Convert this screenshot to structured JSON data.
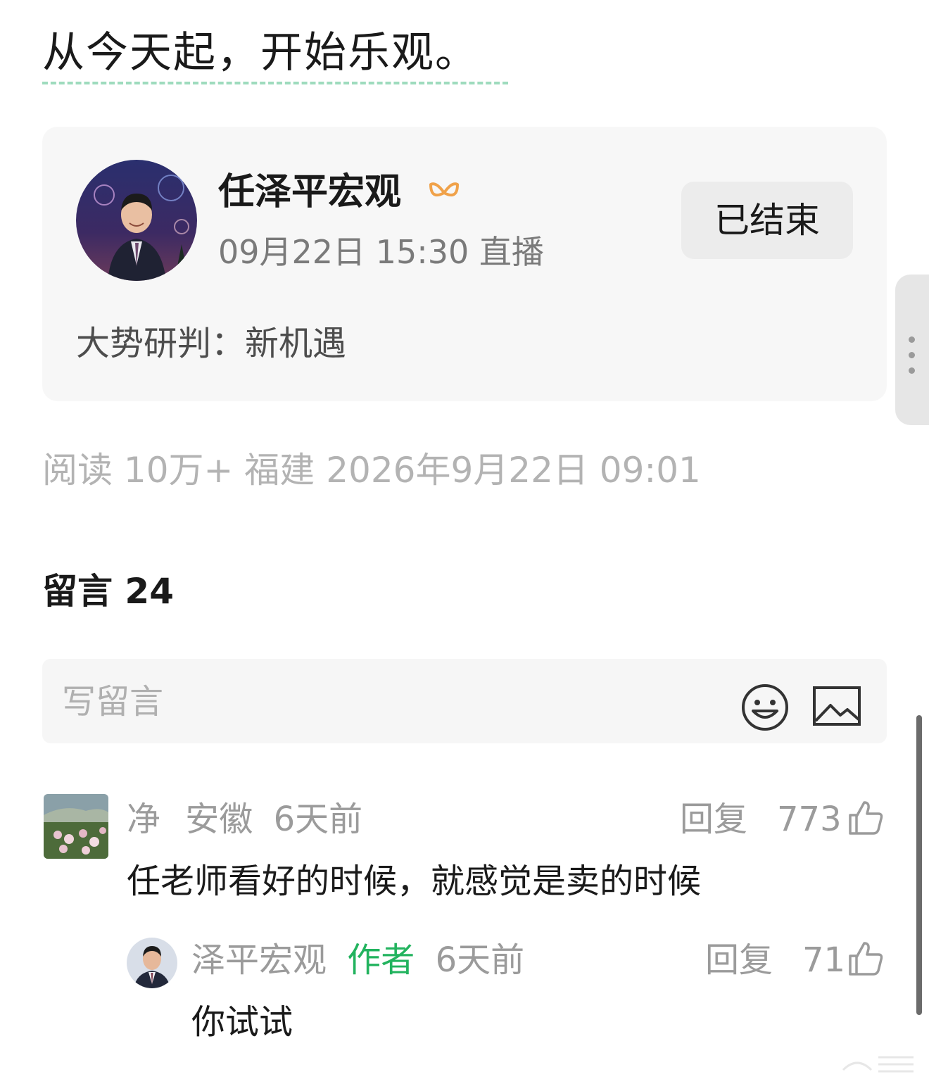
{
  "article": {
    "headline": "从今天起，开始乐观。"
  },
  "live_card": {
    "channel_name": "任泽平宏观",
    "time": "09月22日 15:30 直播",
    "status_button": "已结束",
    "topic": "大势研判：新机遇",
    "verified_color": "#f0a24a"
  },
  "meta": {
    "text": "阅读 10万+ 福建 2026年9月22日 09:01"
  },
  "comments": {
    "heading": "留言 24",
    "input_placeholder": "写留言",
    "items": [
      {
        "name": "净",
        "location": "安徽",
        "time": "6天前",
        "reply_label": "回复",
        "likes": "773",
        "text": "任老师看好的时候，就感觉是卖的时候",
        "replies": [
          {
            "name": "泽平宏观",
            "tag": "作者",
            "time": "6天前",
            "reply_label": "回复",
            "likes": "71",
            "text": "你试试"
          }
        ]
      }
    ]
  },
  "colors": {
    "accent_green": "#22b35e",
    "underline_green": "#9edbbd",
    "card_bg": "#f7f7f7"
  }
}
